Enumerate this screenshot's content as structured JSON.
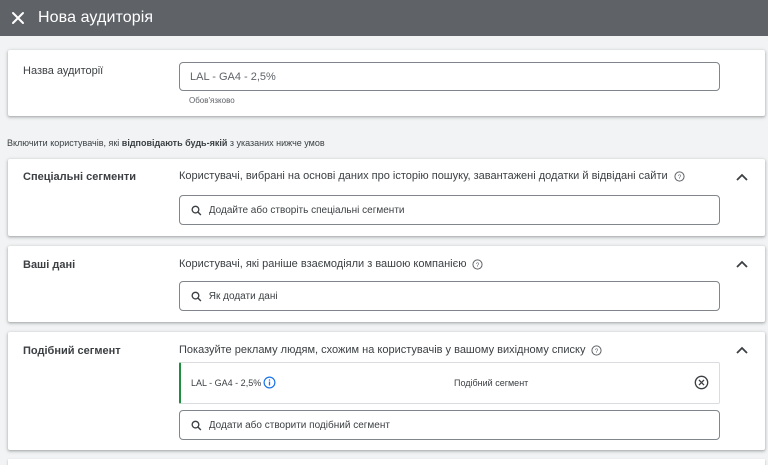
{
  "header": {
    "title": "Нова аудиторія",
    "close_icon": "close-icon"
  },
  "audience_name": {
    "label": "Назва аудиторії",
    "value": "LAL - GA4 - 2,5%",
    "hint": "Обов'язково"
  },
  "include_text": {
    "prefix": "Включити користувачів, які ",
    "bold": "відповідають будь-якій",
    "suffix": " з указаних нижче умов"
  },
  "custom_segments": {
    "label": "Спеціальні сегменти",
    "description": "Користувачі, вибрані на основі даних про історію пошуку, завантажені додатки й відвідані сайти",
    "search_placeholder": "Додайте або створіть спеціальні сегменти"
  },
  "your_data": {
    "label": "Ваші дані",
    "description": "Користувачі, які раніше взаємодіяли з вашою компанією",
    "search_placeholder": "Як додати дані"
  },
  "similar_segment": {
    "label": "Подібний сегмент",
    "description": "Показуйте рекламу людям, схожим на користувачів у вашому вихідному списку",
    "selected": {
      "name": "LAL - GA4 - 2,5%",
      "type": "Подібний сегмент"
    },
    "search_placeholder": "Додати або створити подібний сегмент"
  },
  "colors": {
    "topbar": "#5f6368",
    "accent_green": "#1e8e3e",
    "info_blue": "#1a73e8"
  }
}
